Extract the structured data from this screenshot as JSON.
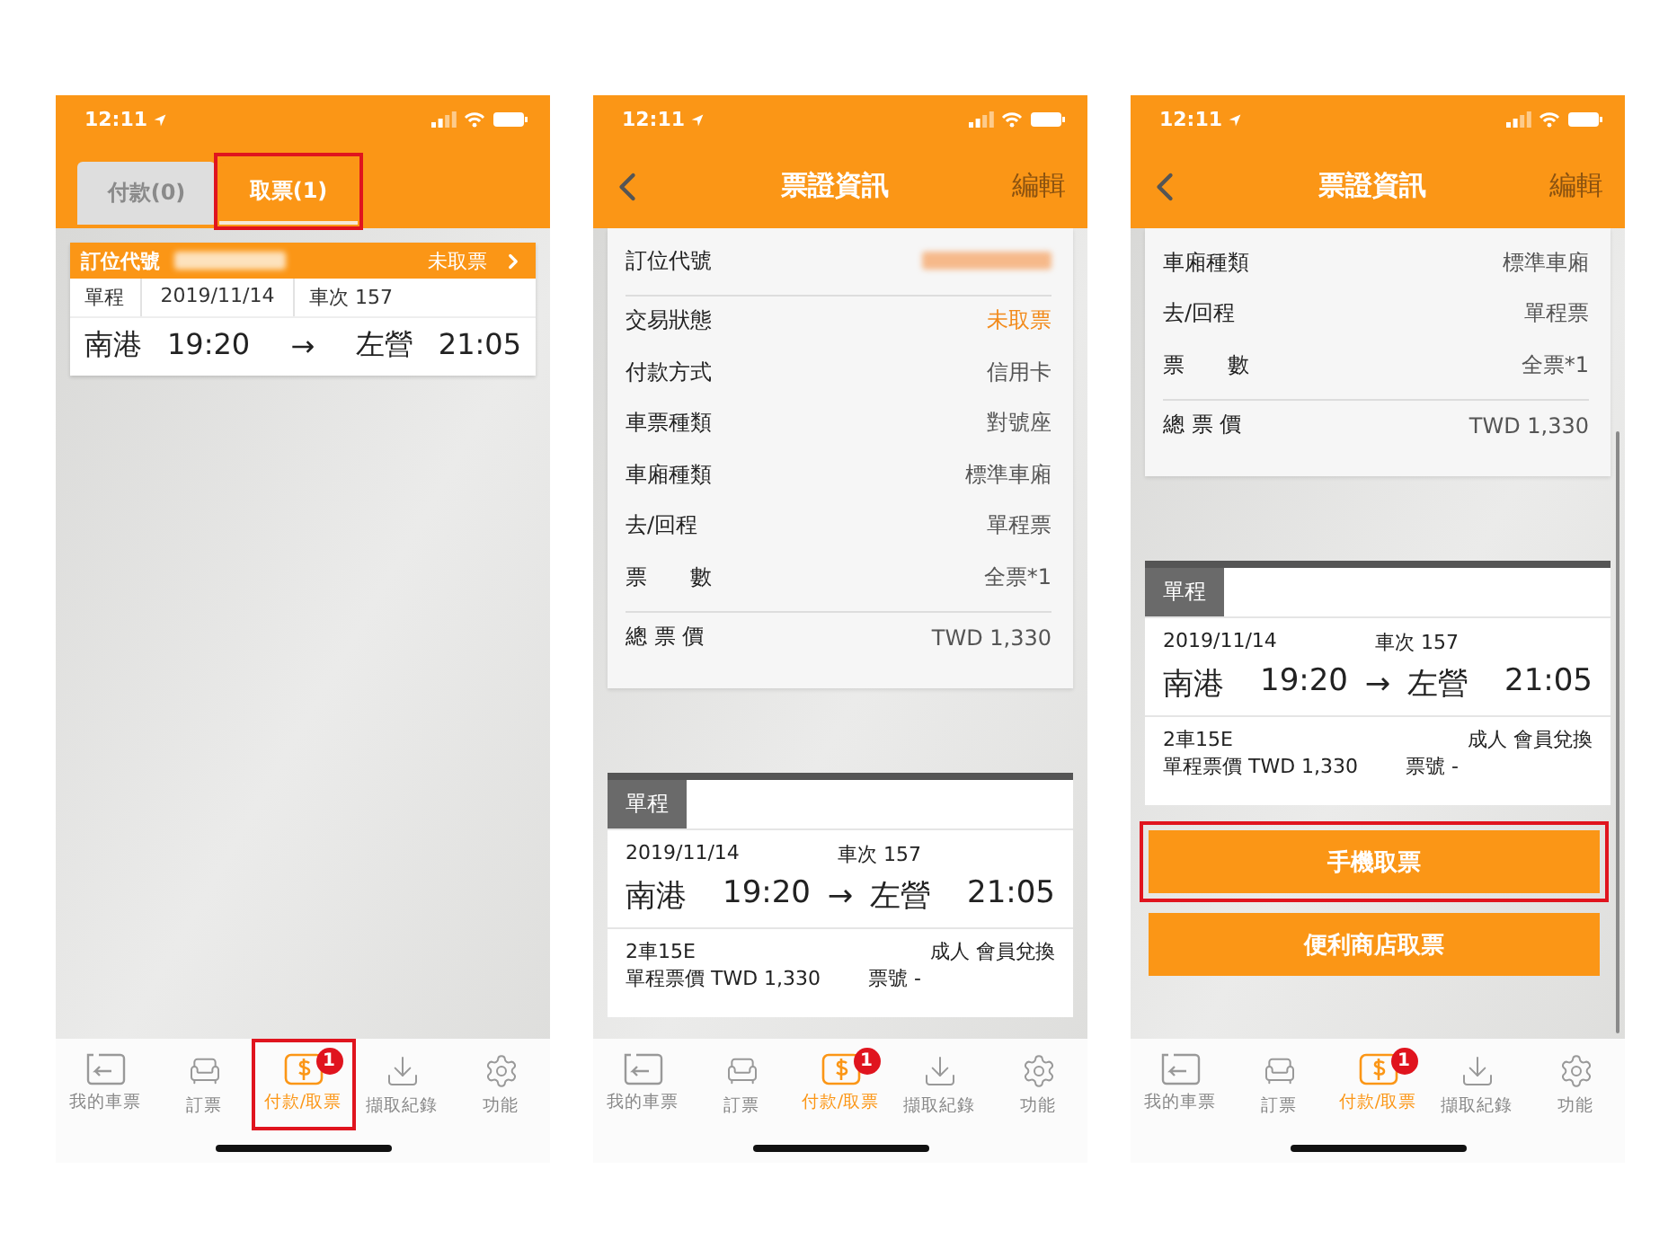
{
  "phones": [
    {
      "status_time": "12:11",
      "tabs": [
        {
          "label": "付款(0)",
          "selected": false,
          "highlighted": false
        },
        {
          "label": "取票(1)",
          "selected": true,
          "highlighted": true
        }
      ],
      "orders": [
        {
          "code_label": "訂位代號",
          "status": "未取票",
          "trip": "單程",
          "date": "2019/11/14",
          "train": "車次 157",
          "from": "南港",
          "depart": "19:20",
          "arrow": "→",
          "to": "左營",
          "arrive": "21:05"
        }
      ],
      "tab_bar": [
        {
          "label": "我的車票",
          "selected": false,
          "highlighted": false
        },
        {
          "label": "訂票",
          "selected": false,
          "highlighted": false
        },
        {
          "label": "付款/取票",
          "selected": true,
          "highlighted": true,
          "badge": "1"
        },
        {
          "label": "擷取紀錄",
          "selected": false,
          "highlighted": false
        },
        {
          "label": "功能",
          "selected": false,
          "highlighted": false
        }
      ]
    },
    {
      "status_time": "12:11",
      "nav": {
        "title": "票證資訊",
        "action": "編輯"
      },
      "details": [
        {
          "label": "訂位代號",
          "kind": "code",
          "separated": false
        },
        {
          "label": "交易狀態",
          "value": "未取票",
          "kind": "status",
          "separated": true
        },
        {
          "label": "付款方式",
          "value": "信用卡",
          "kind": "plain",
          "separated": false
        },
        {
          "label": "車票種類",
          "value": "對號座",
          "kind": "plain",
          "separated": false
        },
        {
          "label": "車廂種類",
          "value": "標準車廂",
          "kind": "plain",
          "separated": false
        },
        {
          "label": "去/回程",
          "value": "單程票",
          "kind": "plain",
          "separated": false
        },
        {
          "label": "票　　數",
          "value": "全票*1",
          "kind": "plain",
          "separated": false
        },
        {
          "label": "總 票 價",
          "value": "TWD 1,330",
          "kind": "plain",
          "separated": true
        }
      ],
      "trip": {
        "header": "單程",
        "date": "2019/11/14",
        "train": "車次 157",
        "from": "南港",
        "depart": "19:20",
        "arrow": "→",
        "to": "左營",
        "arrive": "21:05",
        "seat": "2車15E",
        "passenger": "成人",
        "fare_type": "會員兌換",
        "price": "單程票價 TWD 1,330",
        "ticket_no": "票號 -"
      },
      "tab_bar": [
        {
          "label": "我的車票",
          "selected": false,
          "highlighted": false
        },
        {
          "label": "訂票",
          "selected": false,
          "highlighted": false
        },
        {
          "label": "付款/取票",
          "selected": true,
          "highlighted": false,
          "badge": "1"
        },
        {
          "label": "擷取紀錄",
          "selected": false,
          "highlighted": false
        },
        {
          "label": "功能",
          "selected": false,
          "highlighted": false
        }
      ]
    },
    {
      "status_time": "12:11",
      "scrollbar": true,
      "nav": {
        "title": "票證資訊",
        "action": "編輯"
      },
      "details": [
        {
          "label": "車廂種類",
          "value": "標準車廂",
          "kind": "plain",
          "separated": false
        },
        {
          "label": "去/回程",
          "value": "單程票",
          "kind": "plain",
          "separated": false
        },
        {
          "label": "票　　數",
          "value": "全票*1",
          "kind": "plain",
          "separated": false
        },
        {
          "label": "總 票 價",
          "value": "TWD 1,330",
          "kind": "plain",
          "separated": true
        }
      ],
      "trip": {
        "header": "單程",
        "date": "2019/11/14",
        "train": "車次 157",
        "from": "南港",
        "depart": "19:20",
        "arrow": "→",
        "to": "左營",
        "arrive": "21:05",
        "seat": "2車15E",
        "passenger": "成人",
        "fare_type": "會員兌換",
        "price": "單程票價 TWD 1,330",
        "ticket_no": "票號 -"
      },
      "buttons": [
        {
          "label": "手機取票",
          "highlighted": true
        },
        {
          "label": "便利商店取票",
          "highlighted": false
        }
      ],
      "tab_bar": [
        {
          "label": "我的車票",
          "selected": false,
          "highlighted": false
        },
        {
          "label": "訂票",
          "selected": false,
          "highlighted": false
        },
        {
          "label": "付款/取票",
          "selected": true,
          "highlighted": false,
          "badge": "1"
        },
        {
          "label": "擷取紀錄",
          "selected": false,
          "highlighted": false
        },
        {
          "label": "功能",
          "selected": false,
          "highlighted": false
        }
      ]
    }
  ]
}
